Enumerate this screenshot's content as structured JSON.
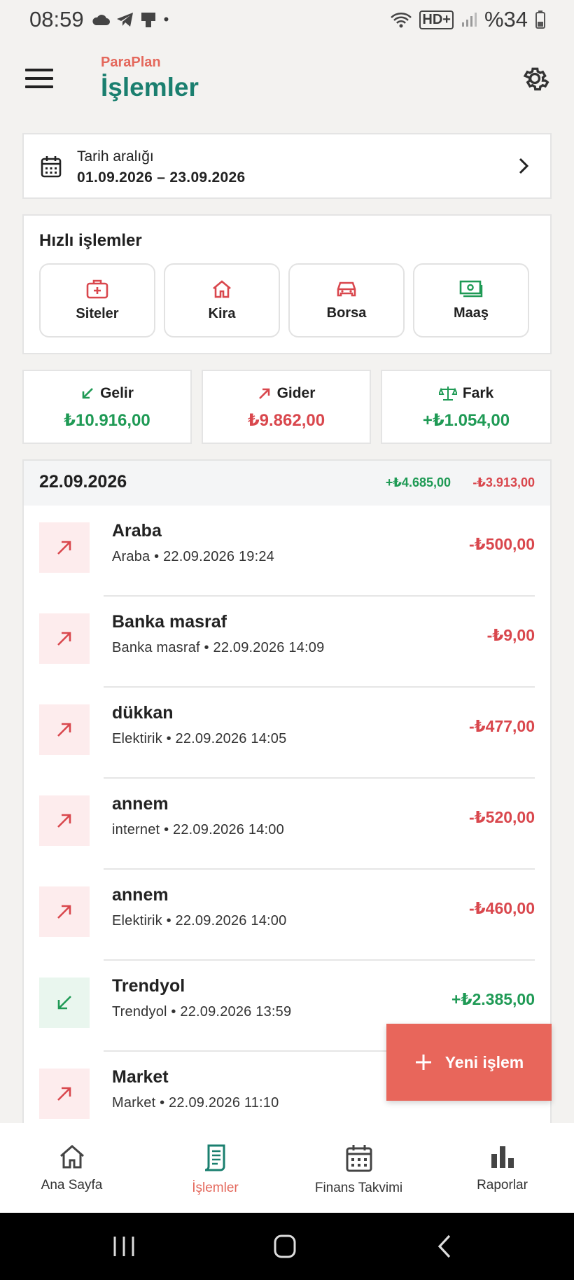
{
  "status_bar": {
    "time": "08:59",
    "battery": "%34"
  },
  "header": {
    "brand": "ParaPlan",
    "title": "İşlemler"
  },
  "date_range": {
    "label": "Tarih aralığı",
    "value": "01.09.2026 – 23.09.2026"
  },
  "quick": {
    "title": "Hızlı işlemler",
    "items": [
      {
        "label": "Siteler",
        "icon": "medkit-icon"
      },
      {
        "label": "Kira",
        "icon": "home-icon"
      },
      {
        "label": "Borsa",
        "icon": "car-icon"
      },
      {
        "label": "Maaş",
        "icon": "money-icon"
      }
    ]
  },
  "summary": {
    "income": {
      "label": "Gelir",
      "value": "₺10.916,00"
    },
    "expense": {
      "label": "Gider",
      "value": "₺9.862,00"
    },
    "diff": {
      "label": "Fark",
      "value": "+₺1.054,00"
    }
  },
  "day": {
    "date": "22.09.2026",
    "income": "+₺4.685,00",
    "expense": "-₺3.913,00"
  },
  "transactions": [
    {
      "title": "Araba",
      "sub": "Araba • 22.09.2026 19:24",
      "amount": "-₺500,00",
      "type": "expense"
    },
    {
      "title": "Banka masraf",
      "sub": "Banka masraf • 22.09.2026 14:09",
      "amount": "-₺9,00",
      "type": "expense"
    },
    {
      "title": "dükkan",
      "sub": "Elektirik • 22.09.2026 14:05",
      "amount": "-₺477,00",
      "type": "expense"
    },
    {
      "title": "annem",
      "sub": "internet • 22.09.2026 14:00",
      "amount": "-₺520,00",
      "type": "expense"
    },
    {
      "title": "annem",
      "sub": "Elektirik • 22.09.2026 14:00",
      "amount": "-₺460,00",
      "type": "expense"
    },
    {
      "title": "Trendyol",
      "sub": "Trendyol • 22.09.2026 13:59",
      "amount": "+₺2.385,00",
      "type": "income"
    },
    {
      "title": "Market",
      "sub": "Market • 22.09.2026 11:10",
      "amount": "",
      "type": "expense"
    }
  ],
  "fab": {
    "label": "Yeni işlem"
  },
  "nav": [
    {
      "label": "Ana Sayfa",
      "icon": "home-icon"
    },
    {
      "label": "İşlemler",
      "icon": "receipt-icon"
    },
    {
      "label": "Finans Takvimi",
      "icon": "calendar-icon"
    },
    {
      "label": "Raporlar",
      "icon": "bar-chart-icon"
    }
  ],
  "colors": {
    "accent": "#e4685c",
    "title": "#1a7f6f",
    "income": "#1f9a55",
    "expense": "#d9474d"
  }
}
